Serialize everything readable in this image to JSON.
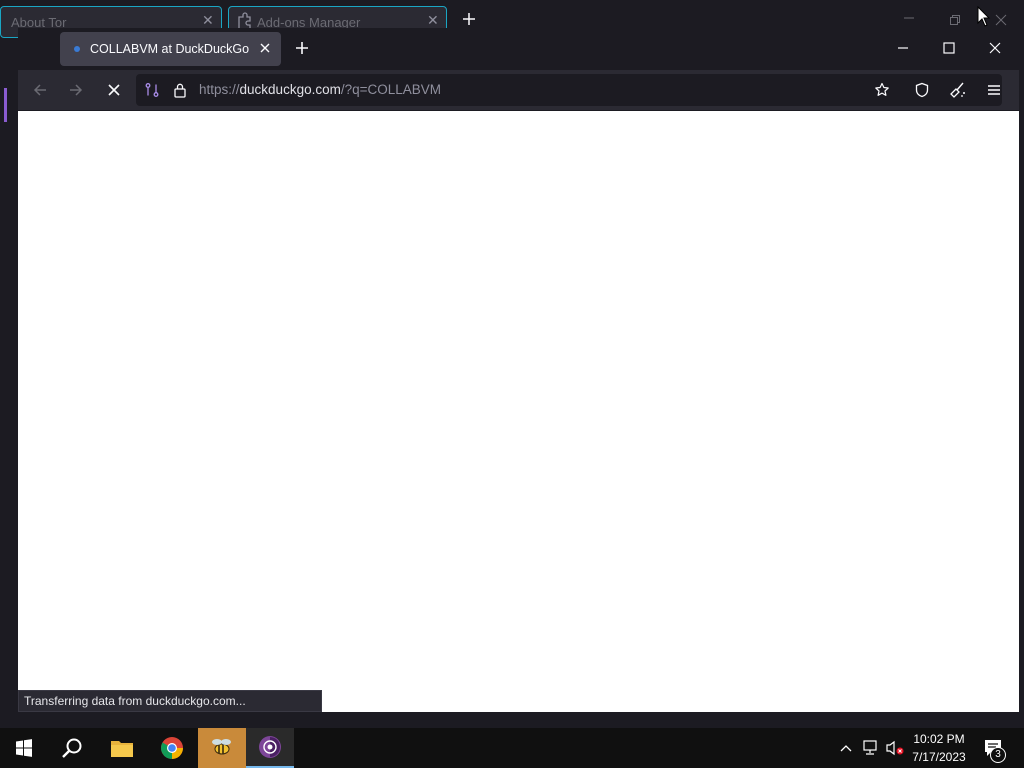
{
  "background_window": {
    "tab1_title": "About Tor",
    "tab2_title": "Add-ons Manager"
  },
  "browser": {
    "active_tab": {
      "title": "COLLABVM at DuckDuckGo"
    },
    "url": {
      "prefix": "https://",
      "host": "duckduckgo.com",
      "path": "/?q=COLLABVM"
    },
    "status_text": "Transferring data from duckduckgo.com..."
  },
  "taskbar": {
    "time": "10:02 PM",
    "date": "7/17/2023",
    "notification_count": "3",
    "apps": [
      "start-icon",
      "search-icon",
      "file-explorer-icon",
      "chrome-icon",
      "bee-app-icon",
      "tor-browser-icon"
    ]
  },
  "colors": {
    "accent": "#1aa6c4",
    "window_bg": "#1c1b22",
    "toolbar_bg": "#2b2a33",
    "active_tab_bg": "#42414d",
    "taskbar_bg": "#101010"
  }
}
